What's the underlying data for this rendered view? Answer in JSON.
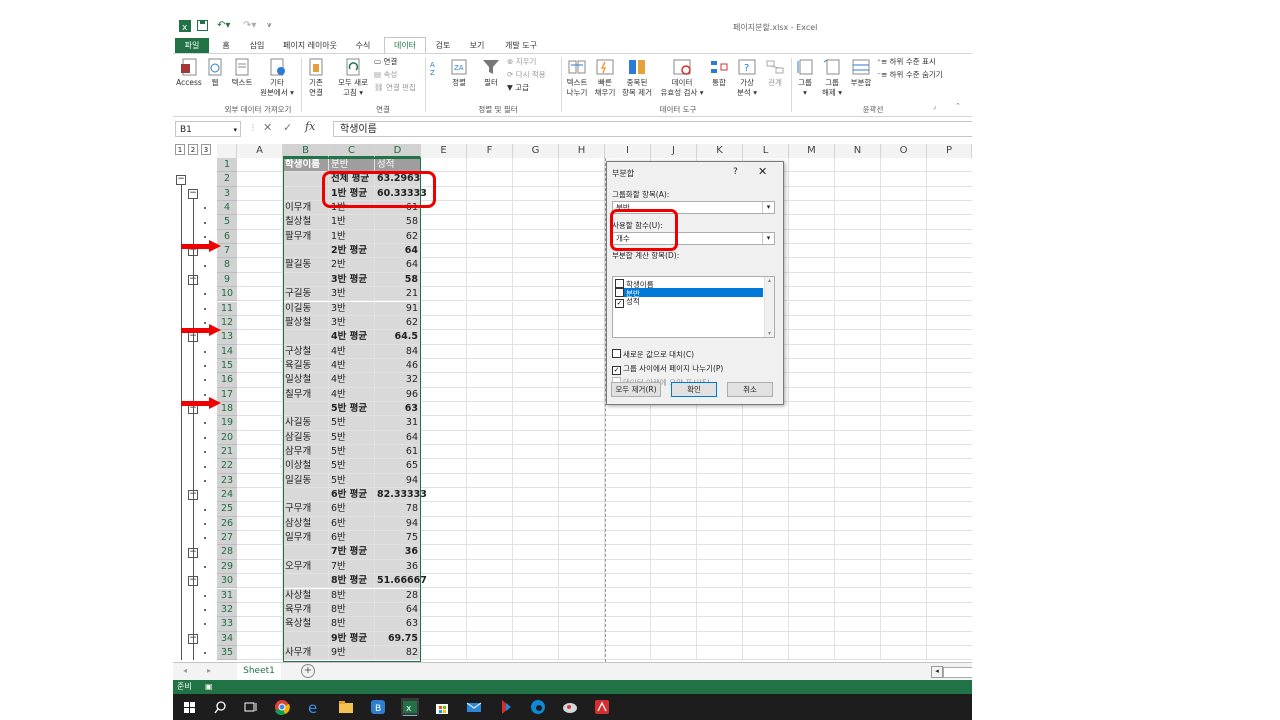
{
  "window": {
    "title": "페이지분할.xlsx - Excel"
  },
  "tabs": [
    "파일",
    "홈",
    "삽입",
    "페이지 레이아웃",
    "수식",
    "데이터",
    "검토",
    "보기",
    "개발 도구"
  ],
  "active_tab": "데이터",
  "ribbon": {
    "ext_group": {
      "label": "외부 데이터 가져오기",
      "access": "Access",
      "web": "웹",
      "text": "텍스트",
      "other1": "기타",
      "other2": "원본에서 ▾"
    },
    "conn_group": {
      "label": "연결",
      "existing1": "기존",
      "existing2": "연결",
      "refresh1": "모두 새로",
      "refresh2": "고침 ▾",
      "connections": "연결",
      "properties": "속성",
      "edit_links": "연결 편집"
    },
    "sort_group": {
      "label": "정렬 및 필터",
      "sort": "정렬",
      "filter": "필터",
      "clear": "지우기",
      "reapply": "다시 적용",
      "advanced": "고급"
    },
    "tools_group": {
      "label": "데이터 도구",
      "text_to_col1": "텍스트",
      "text_to_col2": "나누기",
      "flash1": "빠른",
      "flash2": "채우기",
      "remove_dup1": "중복된",
      "remove_dup2": "항목 제거",
      "validation1": "데이터",
      "validation2": "유효성 검사 ▾",
      "consolidate": "통합",
      "whatif1": "가상",
      "whatif2": "분석 ▾",
      "relations": "관계"
    },
    "outline_group": {
      "label": "윤곽선",
      "group1": "그룹",
      "group2": "▾",
      "ungroup1": "그룹",
      "ungroup2": "해제 ▾",
      "subtotal": "부분합",
      "show_detail": "하위 수준 표시",
      "hide_detail": "하위 수준 숨기기"
    }
  },
  "name_box": "B1",
  "formula": "학생이름",
  "outline_levels": [
    "1",
    "2",
    "3"
  ],
  "columns": [
    "A",
    "B",
    "C",
    "D",
    "E",
    "F",
    "G",
    "H",
    "I",
    "J",
    "K",
    "L",
    "M",
    "N",
    "O",
    "P"
  ],
  "rows": [
    {
      "n": "1",
      "b": "학생이름",
      "c": "분반",
      "d": "성적",
      "hdr": true
    },
    {
      "n": "2",
      "b": "",
      "c": "전체 평균",
      "d": "63.2963",
      "sub": true
    },
    {
      "n": "3",
      "b": "",
      "c": "1반 평균",
      "d": "60.33333",
      "sub": true
    },
    {
      "n": "4",
      "b": "이무개",
      "c": "1반",
      "d": "61"
    },
    {
      "n": "5",
      "b": "칠상철",
      "c": "1반",
      "d": "58"
    },
    {
      "n": "6",
      "b": "팔무개",
      "c": "1반",
      "d": "62"
    },
    {
      "n": "7",
      "b": "",
      "c": "2반 평균",
      "d": "64",
      "sub": true
    },
    {
      "n": "8",
      "b": "팔길동",
      "c": "2반",
      "d": "64"
    },
    {
      "n": "9",
      "b": "",
      "c": "3반 평균",
      "d": "58",
      "sub": true
    },
    {
      "n": "10",
      "b": "구길동",
      "c": "3반",
      "d": "21"
    },
    {
      "n": "11",
      "b": "이길동",
      "c": "3반",
      "d": "91"
    },
    {
      "n": "12",
      "b": "팔상철",
      "c": "3반",
      "d": "62"
    },
    {
      "n": "13",
      "b": "",
      "c": "4반 평균",
      "d": "64.5",
      "sub": true
    },
    {
      "n": "14",
      "b": "구상철",
      "c": "4반",
      "d": "84"
    },
    {
      "n": "15",
      "b": "육길동",
      "c": "4반",
      "d": "46"
    },
    {
      "n": "16",
      "b": "일상철",
      "c": "4반",
      "d": "32"
    },
    {
      "n": "17",
      "b": "칠무개",
      "c": "4반",
      "d": "96"
    },
    {
      "n": "18",
      "b": "",
      "c": "5반 평균",
      "d": "63",
      "sub": true
    },
    {
      "n": "19",
      "b": "사길동",
      "c": "5반",
      "d": "31"
    },
    {
      "n": "20",
      "b": "삼길동",
      "c": "5반",
      "d": "64"
    },
    {
      "n": "21",
      "b": "삼무개",
      "c": "5반",
      "d": "61"
    },
    {
      "n": "22",
      "b": "이상철",
      "c": "5반",
      "d": "65"
    },
    {
      "n": "23",
      "b": "일길동",
      "c": "5반",
      "d": "94"
    },
    {
      "n": "24",
      "b": "",
      "c": "6반 평균",
      "d": "82.33333",
      "sub": true
    },
    {
      "n": "25",
      "b": "구무개",
      "c": "6반",
      "d": "78"
    },
    {
      "n": "26",
      "b": "삼상철",
      "c": "6반",
      "d": "94"
    },
    {
      "n": "27",
      "b": "일무개",
      "c": "6반",
      "d": "75"
    },
    {
      "n": "28",
      "b": "",
      "c": "7반 평균",
      "d": "36",
      "sub": true
    },
    {
      "n": "29",
      "b": "오무개",
      "c": "7반",
      "d": "36"
    },
    {
      "n": "30",
      "b": "",
      "c": "8반 평균",
      "d": "51.66667",
      "sub": true
    },
    {
      "n": "31",
      "b": "사상철",
      "c": "8반",
      "d": "28"
    },
    {
      "n": "32",
      "b": "육무개",
      "c": "8반",
      "d": "64"
    },
    {
      "n": "33",
      "b": "육상철",
      "c": "8반",
      "d": "63"
    },
    {
      "n": "34",
      "b": "",
      "c": "9반 평균",
      "d": "69.75",
      "sub": true
    },
    {
      "n": "35",
      "b": "사무개",
      "c": "9반",
      "d": "82"
    }
  ],
  "dialog": {
    "title": "부분합",
    "help": "?",
    "close": "✕",
    "group_by_label": "그룹화할 항목(A):",
    "group_by_value": "분반",
    "function_label": "사용할 함수(U):",
    "function_value": "개수",
    "calc_label": "부분합 계산 항목(D):",
    "calc_items": [
      {
        "label": "학생이름",
        "checked": false,
        "highlight": false
      },
      {
        "label": "분반",
        "checked": false,
        "highlight": true
      },
      {
        "label": "성적",
        "checked": true,
        "highlight": false
      }
    ],
    "opt_replace": "새로운 값으로 대치(C)",
    "opt_pagebreak": "그룹 사이에서 페이지 나누기(P)",
    "opt_summary": "데이터 아래에 요약 표시(S)",
    "btn_remove": "모두 제거(R)",
    "btn_ok": "확인",
    "btn_cancel": "취소"
  },
  "sheet_tab": "Sheet1",
  "status": "준비",
  "colors": {
    "excel_green": "#217346",
    "highlight_red": "#e00000",
    "selection_blue": "#0078d7"
  }
}
